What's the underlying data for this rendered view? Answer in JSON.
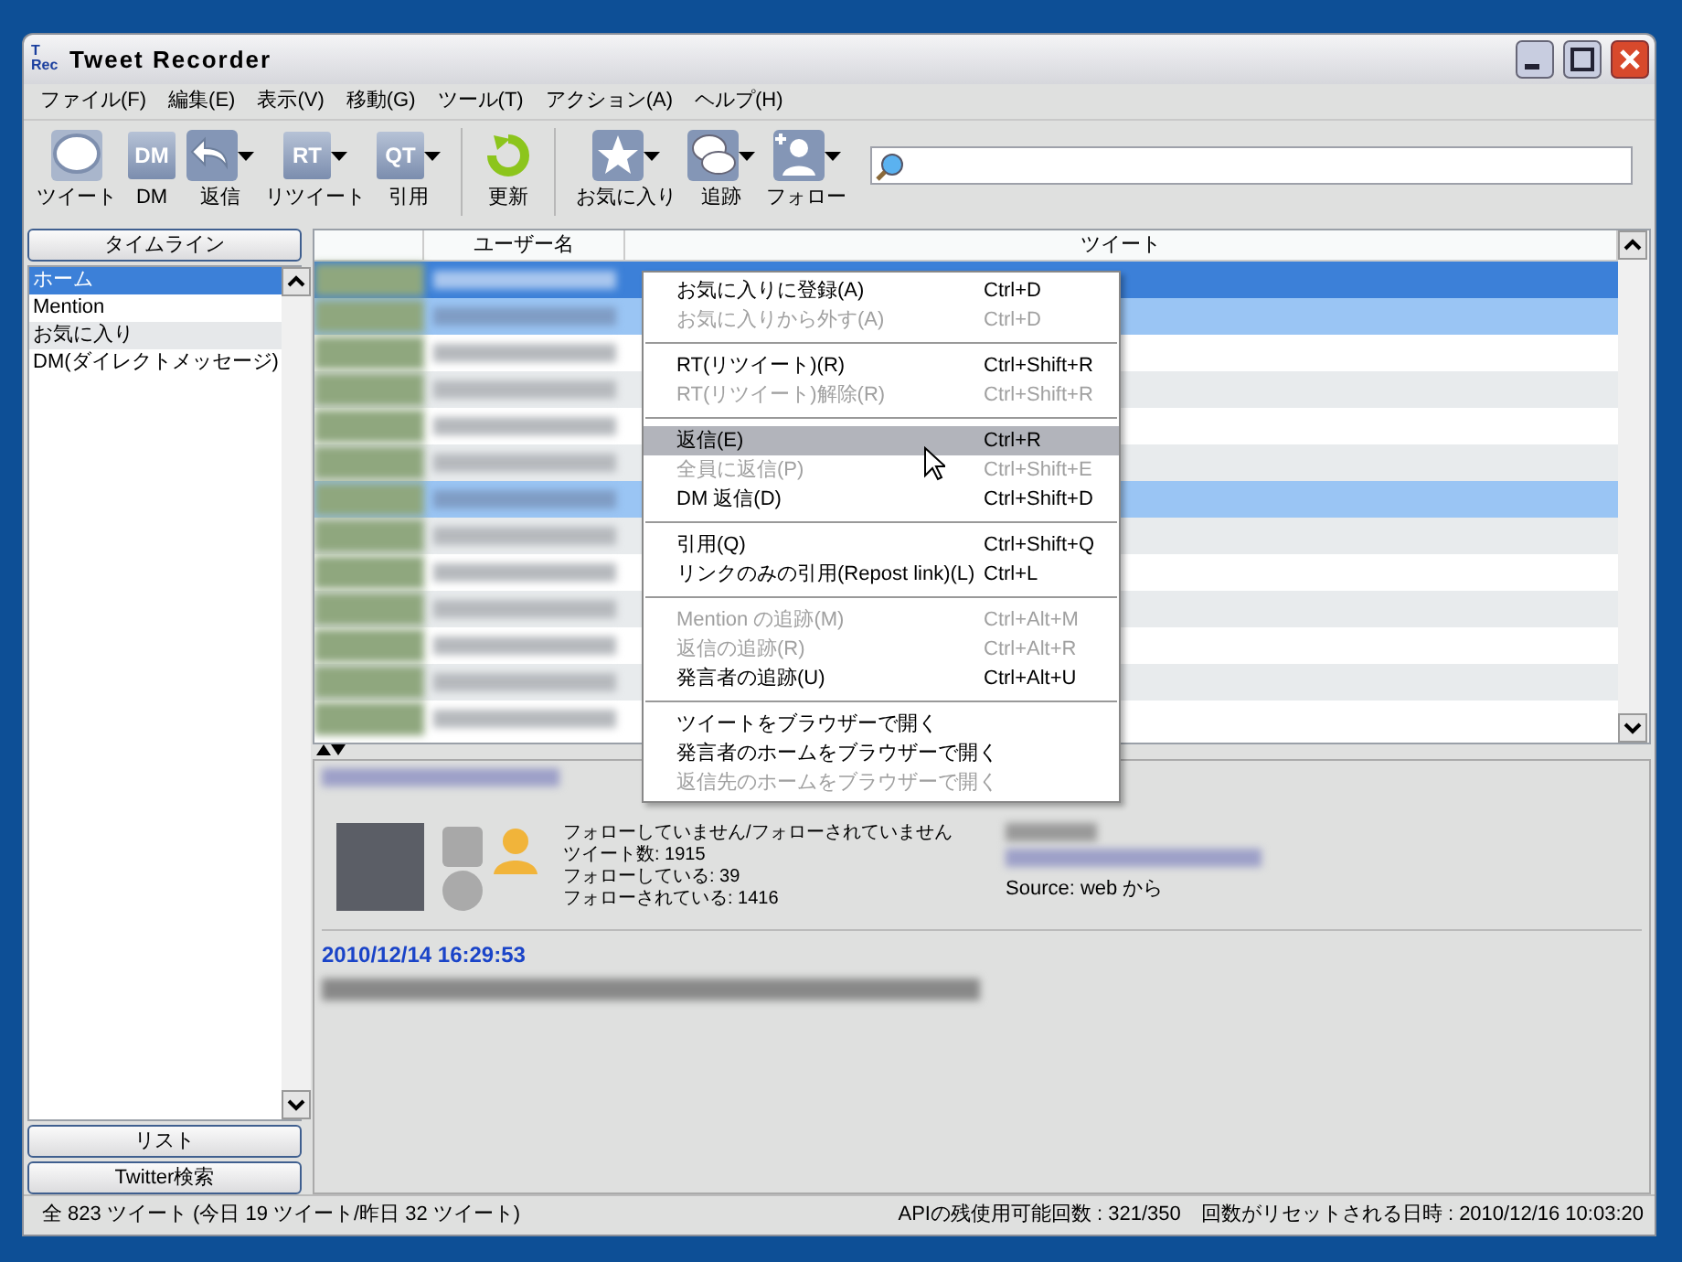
{
  "window": {
    "title": "Tweet Recorder",
    "logo_lines": [
      "T",
      "Rec"
    ]
  },
  "menu_bar": [
    "ファイル(F)",
    "編集(E)",
    "表示(V)",
    "移動(G)",
    "ツール(T)",
    "アクション(A)",
    "ヘルプ(H)"
  ],
  "toolbar": [
    {
      "kind": "tweet",
      "label": "ツイート",
      "dropdown": false
    },
    {
      "kind": "dm",
      "label": "DM",
      "icon_text": "DM",
      "dropdown": false
    },
    {
      "kind": "reply",
      "label": "返信",
      "dropdown": true
    },
    {
      "kind": "rt",
      "label": "リツイート",
      "icon_text": "RT",
      "dropdown": true
    },
    {
      "kind": "qt",
      "label": "引用",
      "icon_text": "QT",
      "dropdown": true
    },
    {
      "kind": "refresh",
      "label": "更新",
      "dropdown": false
    },
    {
      "kind": "star",
      "label": "お気に入り",
      "dropdown": true
    },
    {
      "kind": "chat",
      "label": "追跡",
      "dropdown": true
    },
    {
      "kind": "follow",
      "label": "フォロー",
      "dropdown": true
    }
  ],
  "sidebar": {
    "header": "タイムライン",
    "items": [
      {
        "label": "ホーム",
        "selected": true,
        "hovered": false
      },
      {
        "label": "Mention",
        "selected": false,
        "hovered": false
      },
      {
        "label": "お気に入り",
        "selected": false,
        "hovered": true
      },
      {
        "label": "DM(ダイレクトメッセージ)",
        "selected": false,
        "hovered": false
      }
    ],
    "buttons": [
      "リスト",
      "Twitter検索"
    ]
  },
  "table": {
    "columns": [
      "ユーザー名",
      "ツイート"
    ],
    "rows": [
      {
        "selected": true,
        "marked": false
      },
      {
        "selected": false,
        "marked": true
      },
      {
        "selected": false,
        "marked": false
      },
      {
        "selected": false,
        "marked": false
      },
      {
        "selected": false,
        "marked": false
      },
      {
        "selected": false,
        "marked": false
      },
      {
        "selected": false,
        "marked": true
      },
      {
        "selected": false,
        "marked": false
      },
      {
        "selected": false,
        "marked": false
      },
      {
        "selected": false,
        "marked": false
      },
      {
        "selected": false,
        "marked": false
      },
      {
        "selected": false,
        "marked": false
      },
      {
        "selected": false,
        "marked": false
      }
    ]
  },
  "context_menu": [
    {
      "kind": "item",
      "label": "お気に入りに登録(A)",
      "shortcut": "Ctrl+D",
      "disabled": false,
      "hovered": false
    },
    {
      "kind": "item",
      "label": "お気に入りから外す(A)",
      "shortcut": "Ctrl+D",
      "disabled": true,
      "hovered": false
    },
    {
      "kind": "separator"
    },
    {
      "kind": "item",
      "label": "RT(リツイート)(R)",
      "shortcut": "Ctrl+Shift+R",
      "disabled": false,
      "hovered": false
    },
    {
      "kind": "item",
      "label": "RT(リツイート)解除(R)",
      "shortcut": "Ctrl+Shift+R",
      "disabled": true,
      "hovered": false
    },
    {
      "kind": "separator"
    },
    {
      "kind": "item",
      "label": "返信(E)",
      "shortcut": "Ctrl+R",
      "disabled": false,
      "hovered": true
    },
    {
      "kind": "item",
      "label": "全員に返信(P)",
      "shortcut": "Ctrl+Shift+E",
      "disabled": true,
      "hovered": false
    },
    {
      "kind": "item",
      "label": "DM 返信(D)",
      "shortcut": "Ctrl+Shift+D",
      "disabled": false,
      "hovered": false
    },
    {
      "kind": "separator"
    },
    {
      "kind": "item",
      "label": "引用(Q)",
      "shortcut": "Ctrl+Shift+Q",
      "disabled": false,
      "hovered": false
    },
    {
      "kind": "item",
      "label": "リンクのみの引用(Repost link)(L)",
      "shortcut": "Ctrl+L",
      "disabled": false,
      "hovered": false
    },
    {
      "kind": "separator"
    },
    {
      "kind": "item",
      "label": "Mention の追跡(M)",
      "shortcut": "Ctrl+Alt+M",
      "disabled": true,
      "hovered": false
    },
    {
      "kind": "item",
      "label": "返信の追跡(R)",
      "shortcut": "Ctrl+Alt+R",
      "disabled": true,
      "hovered": false
    },
    {
      "kind": "item",
      "label": "発言者の追跡(U)",
      "shortcut": "Ctrl+Alt+U",
      "disabled": false,
      "hovered": false
    },
    {
      "kind": "separator"
    },
    {
      "kind": "item",
      "label": "ツイートをブラウザーで開く",
      "disabled": false,
      "hovered": false
    },
    {
      "kind": "item",
      "label": "発言者のホームをブラウザーで開く",
      "disabled": false,
      "hovered": false
    },
    {
      "kind": "item",
      "label": "返信先のホームをブラウザーで開く",
      "disabled": true,
      "hovered": false
    }
  ],
  "detail": {
    "stats": [
      "フォローしていません/フォローされていません",
      "ツイート数: 1915",
      "フォローしている: 39",
      "フォローされている: 1416"
    ],
    "source": "Source: web から",
    "date": "2010/12/14 16:29:53"
  },
  "status_bar": {
    "left": "全 823 ツイート (今日 19 ツイート/昨日 32 ツイート)",
    "right": "APIの残使用可能回数 : 321/350　回数がリセットされる日時 : 2010/12/16 10:03:20"
  }
}
